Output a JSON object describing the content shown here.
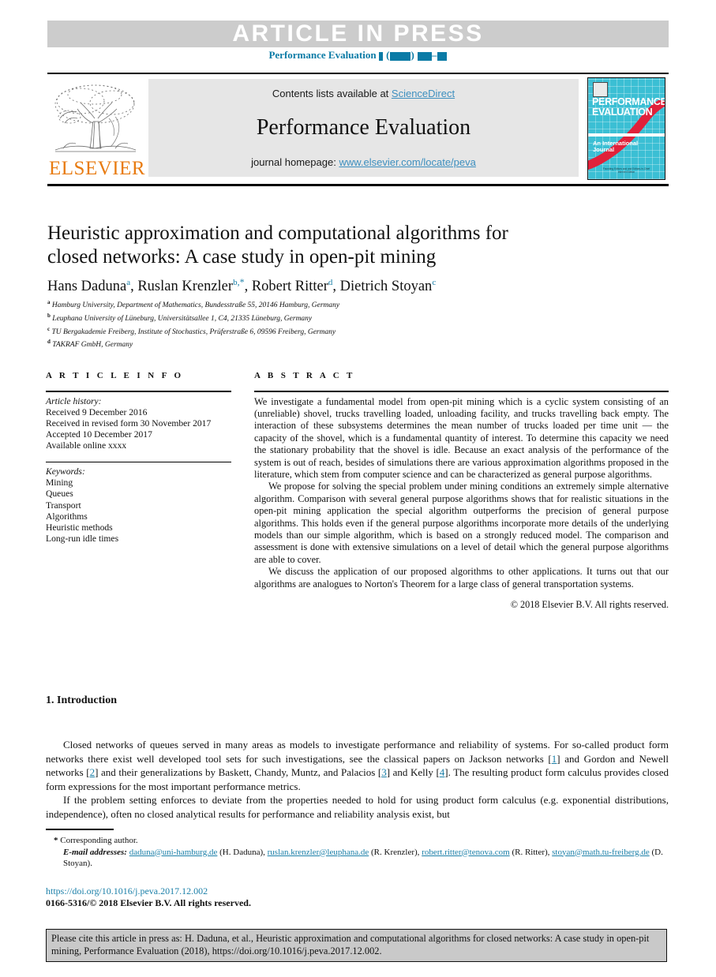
{
  "banner": {
    "article_in_press": "ARTICLE  IN  PRESS",
    "masthead_prefix": "Performance Evaluation"
  },
  "journal_header": {
    "contents_prefix": "Contents lists available at ",
    "sciencedirect_link": "ScienceDirect",
    "journal_name": "Performance Evaluation",
    "homepage_prefix": "journal homepage: ",
    "homepage_link": "www.elsevier.com/locate/peva",
    "publisher_logo_text": "ELSEVIER",
    "cover": {
      "title_line1": "PERFORMANCE",
      "title_line2": "EVALUATION",
      "subtitle_line1": "An International",
      "subtitle_line2": "Journal",
      "footer_line1": "Founding Editors and and Editors-in-Chief",
      "footer_line2": "Internet Edition"
    },
    "colors": {
      "link": "#3d8fbf",
      "elsevier_orange": "#e87b10",
      "cover_cyan": "#3bbfd4",
      "cover_red": "#e0213a"
    }
  },
  "article": {
    "title_line1": "Heuristic approximation and computational algorithms for",
    "title_line2": "closed networks: A case study in open-pit mining",
    "authors": [
      {
        "name": "Hans Daduna",
        "marks": "a",
        "corresponding": false
      },
      {
        "name": "Ruslan Krenzler",
        "marks": "b",
        "corresponding": true
      },
      {
        "name": "Robert Ritter",
        "marks": "d",
        "corresponding": false
      },
      {
        "name": "Dietrich Stoyan",
        "marks": "c",
        "corresponding": false
      }
    ],
    "affiliations": [
      {
        "mark": "a",
        "text": "Hamburg University, Department of Mathematics, Bundesstraße 55, 20146 Hamburg, Germany"
      },
      {
        "mark": "b",
        "text": "Leuphana University of Lüneburg, Universitätsallee 1, C4, 21335 Lüneburg, Germany"
      },
      {
        "mark": "c",
        "text": "TU Bergakademie Freiberg, Institute of Stochastics, Prüferstraße 6, 09596 Freiberg, Germany"
      },
      {
        "mark": "d",
        "text": "TAKRAF GmbH, Germany"
      }
    ]
  },
  "article_info": {
    "heading": "A R T I C L E    I N F O",
    "history_label": "Article history:",
    "history": [
      "Received 9 December 2016",
      "Received in revised form 30 November 2017",
      "Accepted 10 December 2017",
      "Available online xxxx"
    ],
    "keywords_label": "Keywords:",
    "keywords": [
      "Mining",
      "Queues",
      "Transport",
      "Algorithms",
      "Heuristic methods",
      "Long-run idle times"
    ]
  },
  "abstract": {
    "heading": "A B S T R A C T",
    "paragraphs": [
      "We investigate a fundamental model from open-pit mining which is a cyclic system consisting of an (unreliable) shovel, trucks travelling loaded, unloading facility, and trucks travelling back empty. The interaction of these subsystems determines the mean number of trucks loaded per time unit — the capacity of the shovel, which is a fundamental quantity of interest. To determine this capacity we need the stationary probability that the shovel is idle. Because an exact analysis of the performance of the system is out of reach, besides of simulations there are various approximation algorithms proposed in the literature, which stem from computer science and can be characterized as general purpose algorithms.",
      "We propose for solving the special problem under mining conditions an extremely simple alternative algorithm. Comparison with several general purpose algorithms shows that for realistic situations in the open-pit mining application the special algorithm outperforms the precision of general purpose algorithms. This holds even if the general purpose algorithms incorporate more details of the underlying models than our simple algorithm, which is based on a strongly reduced model. The comparison and assessment is done with extensive simulations on a level of detail which the general purpose algorithms are able to cover.",
      "We discuss the application of our proposed algorithms to other applications. It turns out that our algorithms are analogues to Norton's Theorem for a large class of general transportation systems."
    ],
    "copyright": "© 2018 Elsevier B.V. All rights reserved."
  },
  "introduction": {
    "heading": "1. Introduction",
    "paragraph1_part1": "Closed networks of queues served in many areas as models to investigate performance and reliability of systems. For so-called product form networks there exist well developed tool sets for such investigations, see the classical papers on Jackson networks [",
    "ref1": "1",
    "paragraph1_part2": "] and Gordon and Newell networks [",
    "ref2": "2",
    "paragraph1_part3": "] and their generalizations by Baskett, Chandy, Muntz, and Palacios [",
    "ref3": "3",
    "paragraph1_part4": "] and Kelly [",
    "ref4": "4",
    "paragraph1_part5": "]. The resulting product form calculus provides closed form expressions for the most important performance metrics.",
    "paragraph2": "If the problem setting enforces to deviate from the properties needed to hold for using product form calculus (e.g. exponential distributions, independence), often no closed analytical results for performance and reliability analysis exist, but"
  },
  "footnotes": {
    "corresponding_marker": "*",
    "corresponding_text": "Corresponding author.",
    "email_label": "E-mail addresses:",
    "emails": [
      {
        "address": "daduna@uni-hamburg.de",
        "owner": "(H. Daduna)"
      },
      {
        "address": "ruslan.krenzler@leuphana.de",
        "owner": "(R. Krenzler)"
      },
      {
        "address": "robert.ritter@tenova.com",
        "owner": "(R. Ritter)"
      },
      {
        "address": "stoyan@math.tu-freiberg.de",
        "owner": "(D. Stoyan)"
      }
    ],
    "doi": "https://doi.org/10.1016/j.peva.2017.12.002",
    "issn": "0166-5316/© 2018 Elsevier B.V. All rights reserved."
  },
  "cite_box": {
    "text": "Please cite this article in press as: H. Daduna, et al., Heuristic approximation and computational algorithms for closed networks: A case study in open-pit mining, Performance Evaluation (2018), https://doi.org/10.1016/j.peva.2017.12.002."
  }
}
